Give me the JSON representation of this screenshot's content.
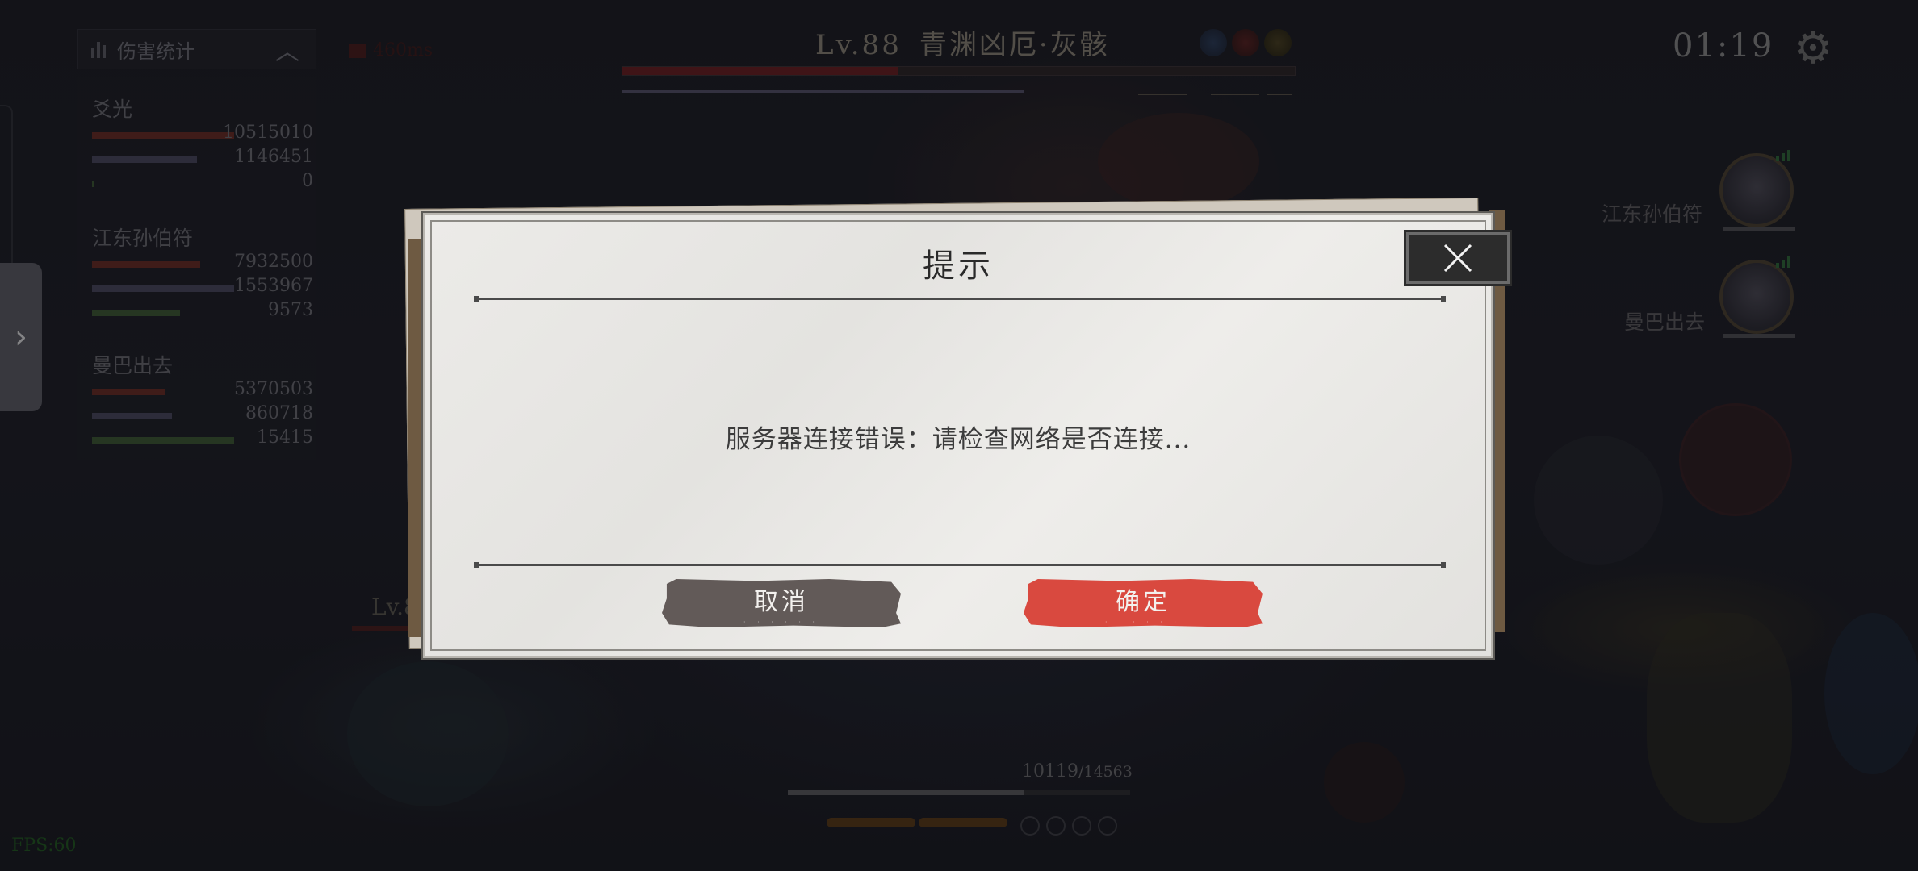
{
  "boss": {
    "level": "Lv.88",
    "name": "青渊凶厄·灰骸",
    "hp_fraction": 0.41,
    "shield_fraction": 0.6
  },
  "timer": "01:19",
  "damage_panel": {
    "title": "伤害统计",
    "players": [
      {
        "name": "爻光",
        "stats": [
          {
            "value": "10515010",
            "fraction": 1.0,
            "color": "#6a2a24"
          },
          {
            "value": "1146451",
            "fraction": 0.74,
            "color": "#4a4860"
          },
          {
            "value": "0",
            "fraction": 0.01,
            "color": "#3c5a34"
          }
        ]
      },
      {
        "name": "江东孙伯符",
        "stats": [
          {
            "value": "7932500",
            "fraction": 0.76,
            "color": "#6a2a24"
          },
          {
            "value": "1553967",
            "fraction": 1.0,
            "color": "#4a4860"
          },
          {
            "value": "9573",
            "fraction": 0.62,
            "color": "#3c5a34"
          }
        ]
      },
      {
        "name": "曼巴出去",
        "stats": [
          {
            "value": "5370503",
            "fraction": 0.51,
            "color": "#6a2a24"
          },
          {
            "value": "860718",
            "fraction": 0.56,
            "color": "#4a4860"
          },
          {
            "value": "15415",
            "fraction": 1.0,
            "color": "#3c5a34"
          }
        ]
      }
    ]
  },
  "ping": "460ms",
  "teammates": [
    {
      "name": "江东孙伯符"
    },
    {
      "name": "曼巴出去"
    }
  ],
  "left_level": "Lv.8",
  "player_hp": {
    "current": "10119",
    "max": "/14563",
    "fraction": 0.69
  },
  "fps": "FPS:60",
  "dialog": {
    "title": "提示",
    "message": "服务器连接错误：请检查网络是否连接...",
    "cancel_label": "取消",
    "confirm_label": "确定",
    "cancel_color": "#625a58",
    "confirm_color": "#d9493f"
  }
}
